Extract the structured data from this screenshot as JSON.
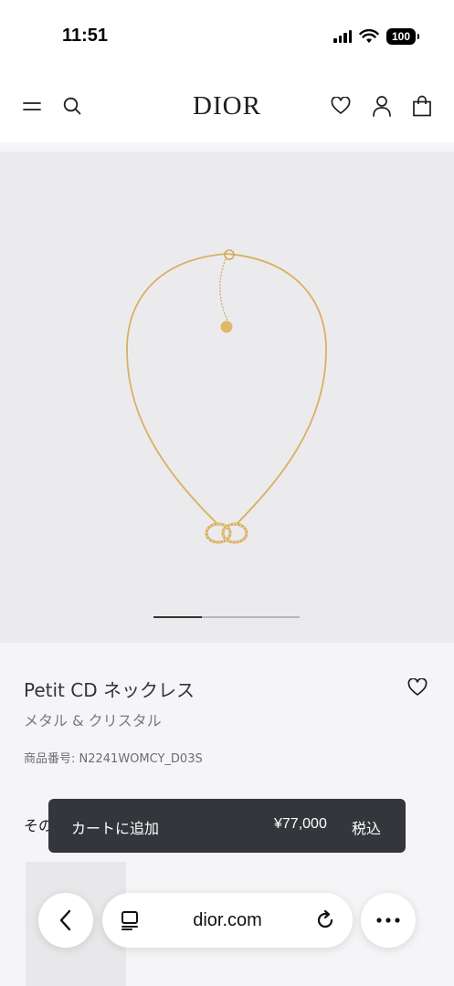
{
  "status_bar": {
    "time": "11:51",
    "battery": "100"
  },
  "header": {
    "logo": "DIOR"
  },
  "product": {
    "name": "Petit CD ネックレス",
    "subtitle": "メタル & クリスタル",
    "code": "商品番号: N2241WOMCY_D03S",
    "image_progress": 0.33
  },
  "section": {
    "other_heading_partial": "その"
  },
  "cart": {
    "label": "カートに追加",
    "price": "¥77,000",
    "tax": "税込"
  },
  "browser": {
    "url": "dior.com"
  },
  "colors": {
    "cart_bar": "#33363a",
    "gold": "#d9b060",
    "image_bg": "#ebebee"
  }
}
